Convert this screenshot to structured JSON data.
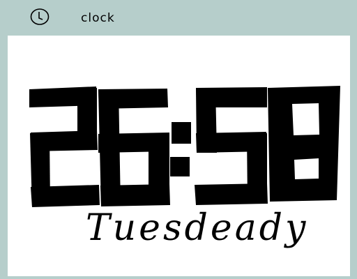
{
  "window": {
    "title": "clock",
    "icon": "clock-icon"
  },
  "clock": {
    "time": "26:58",
    "digits": [
      "2",
      "6",
      "5",
      "8"
    ],
    "separator": ":",
    "day": "Tuesdeady"
  },
  "colors": {
    "chrome": "#b6cecb",
    "face": "#ffffff",
    "ink": "#000000"
  }
}
